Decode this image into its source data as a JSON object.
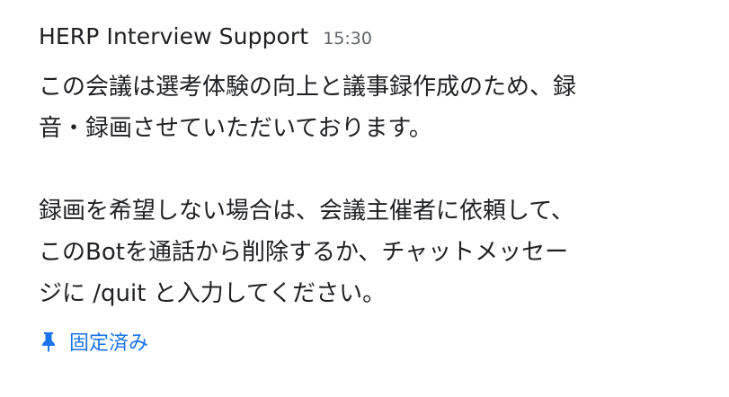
{
  "message": {
    "sender": "HERP Interview Support",
    "timestamp": "15:30",
    "paragraphs": [
      {
        "lines": [
          "この会議は選考体験の向上と議事録作成のため、録",
          "音・録画させていただいております。"
        ]
      },
      {
        "lines": [
          "録画を希望しない場合は、会議主催者に依頼して、",
          "このBotを通話から削除するか、チャットメッセー",
          "ジに /quit と入力してください。"
        ]
      }
    ],
    "pinned_label": "固定済み",
    "pin_icon": "pin-icon",
    "accent_color": "#1a73e8"
  }
}
